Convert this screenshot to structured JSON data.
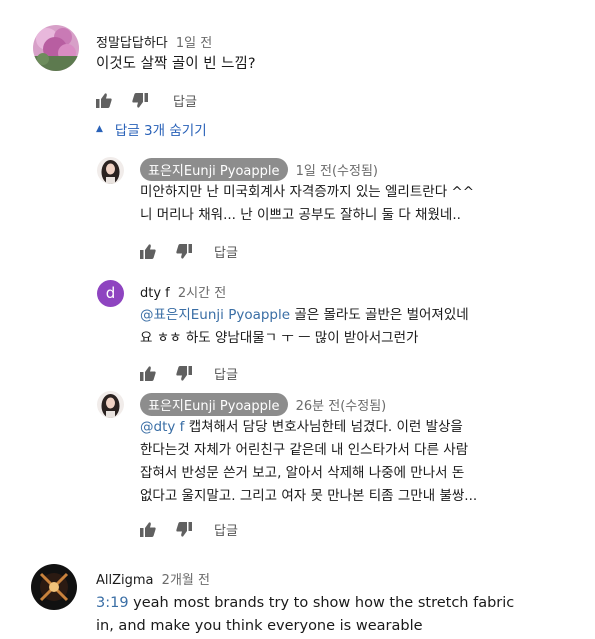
{
  "comments": [
    {
      "author": "정말답답하다",
      "time": "1일 전",
      "lines": [
        "이것도 살짝 골이 빈 느낌?"
      ],
      "reply_label": "답글"
    }
  ],
  "replies_toggle": "답글 3개 숨기기",
  "replies": [
    {
      "author": "표은지Eunji Pyoapple",
      "time": "1일 전(수정됨)",
      "lines": [
        "미안하지만 난 미국회계사 자격증까지 있는 엘리트란다 ^^",
        "니 머리나 채워... 난 이쁘고 공부도 잘하니 둘 다 채웠네.."
      ],
      "reply_label": "답글"
    },
    {
      "author": "dty f",
      "time": "2시간 전",
      "avatar_letter": "d",
      "mention": "@표은지Eunji Pyoapple",
      "line1_rest": " 골은 몰라도 골반은 벌어져있네",
      "line2": "요 ㅎㅎ 하도 양남대물ㄱ ㅜ ㅡ 많이 받아서그런가",
      "reply_label": "답글"
    },
    {
      "author": "표은지Eunji Pyoapple",
      "time": "26분 전(수정됨)",
      "mention": "@dty f",
      "line1_rest": " 캡쳐해서 담당 변호사님한테 넘겼다. 이런 발상을",
      "lines": [
        "한다는것 자체가 어린친구 같은데 내 인스타가서 다른 사람",
        "잡혀서 반성문 쓴거 보고, 알아서 삭제해 나중에 만나서 돈",
        "없다고 울지말고. 그리고 여자 못 만나본 티좀 그만내 불쌍..."
      ],
      "reply_label": "답글"
    }
  ],
  "bottom_comment": {
    "author": "AllZigma",
    "time": "2개월 전",
    "timestamp_link": "3:19",
    "line1_rest": " yeah most brands try to show how the stretch fabric",
    "line2": "in, and make you think everyone is wearable"
  },
  "colors": {
    "link": "#3a6ea5",
    "toggle": "#2a62b8",
    "chip": "#8d8d8d",
    "dty_avatar": "#8e44c0"
  }
}
